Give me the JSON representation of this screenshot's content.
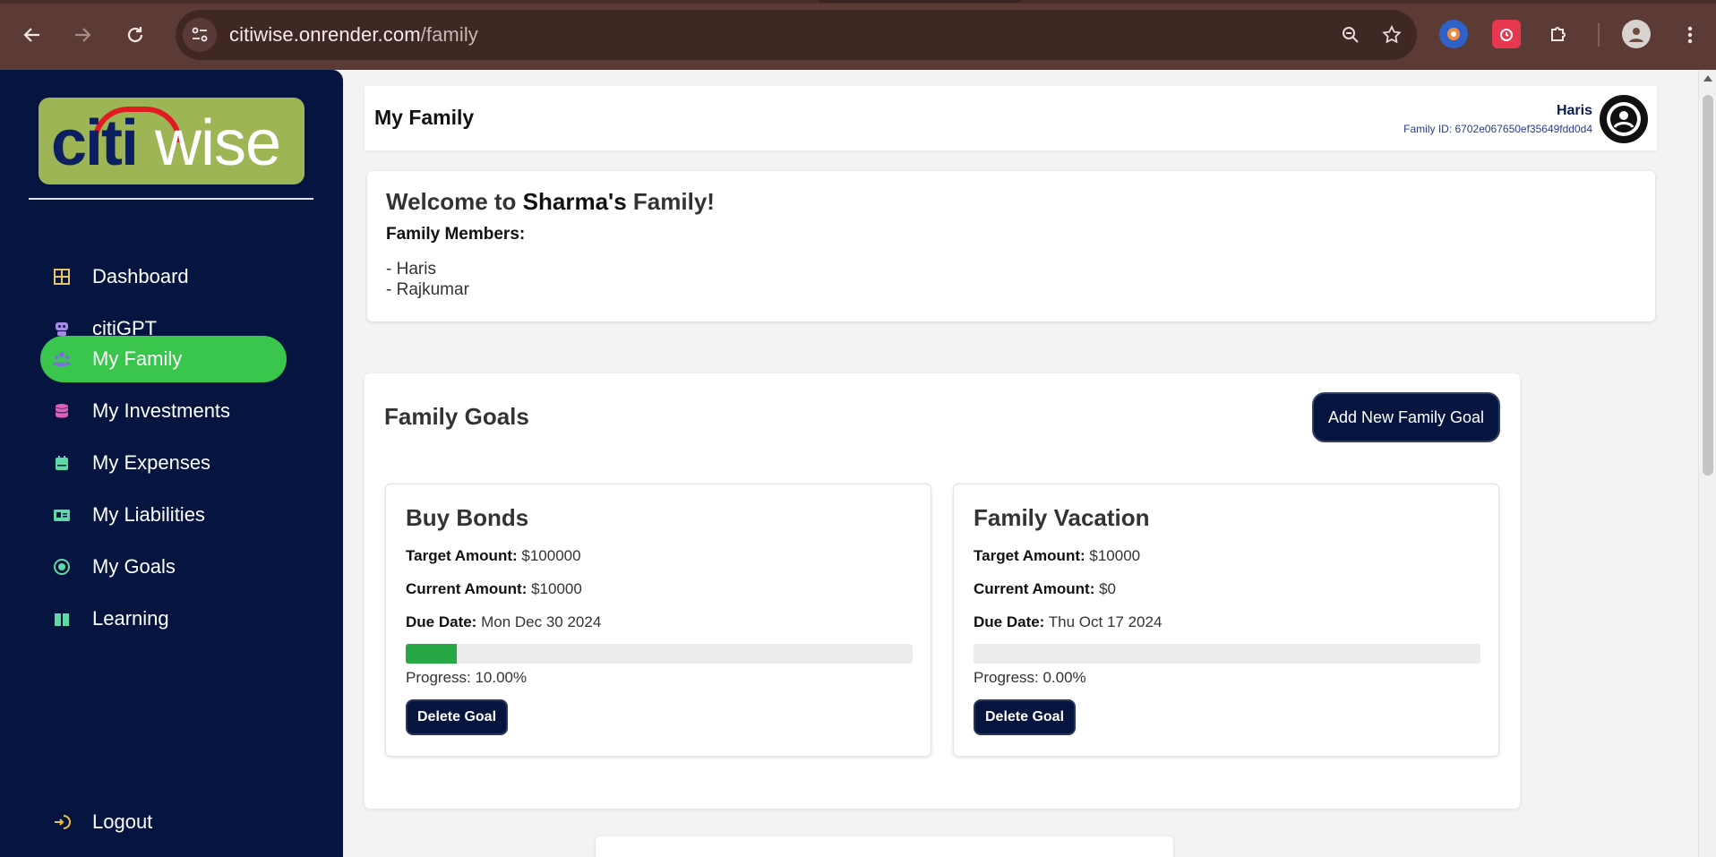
{
  "browser": {
    "url_host": "citiwise.onrender.com",
    "url_path": "/family"
  },
  "sidebar": {
    "logo_text_citi": "citi",
    "logo_text_wise": "wise",
    "items": [
      {
        "label": "Dashboard",
        "icon": "grid-icon",
        "color": "#e7c36a"
      },
      {
        "label": "citiGPT",
        "icon": "robot-icon",
        "color": "#a88be6"
      },
      {
        "label": "My Family",
        "icon": "family-icon",
        "color": "#7b6fe0"
      },
      {
        "label": "My Investments",
        "icon": "database-icon",
        "color": "#e05fb4"
      },
      {
        "label": "My Expenses",
        "icon": "calendar-icon",
        "color": "#5fd8a5"
      },
      {
        "label": "My Liabilities",
        "icon": "id-card-icon",
        "color": "#5fd8a5"
      },
      {
        "label": "My Goals",
        "icon": "target-icon",
        "color": "#5fd8a5"
      },
      {
        "label": "Learning",
        "icon": "book-icon",
        "color": "#5fd8a5"
      }
    ],
    "logout": "Logout"
  },
  "header": {
    "title": "My Family",
    "user_name": "Haris",
    "family_id": "Family ID: 6702e067650ef35649fdd0d4"
  },
  "welcome": {
    "prefix": "Welcome to ",
    "family_name": "Sharma's",
    "suffix": " Family!",
    "members_label": "Family Members:",
    "members": [
      "- Haris",
      "- Rajkumar"
    ]
  },
  "goals": {
    "title": "Family Goals",
    "add_button": "Add New Family Goal",
    "delete_label": "Delete Goal",
    "target_label": "Target Amount:",
    "current_label": "Current Amount:",
    "due_label": "Due Date:",
    "items": [
      {
        "name": "Buy Bonds",
        "target": "$100000",
        "current": "$10000",
        "due": "Mon Dec 30 2024",
        "progress": 0.1,
        "progress_text": "Progress: 10.00%"
      },
      {
        "name": "Family Vacation",
        "target": "$10000",
        "current": "$0",
        "due": "Thu Oct 17 2024",
        "progress": 0.0,
        "progress_text": "Progress: 0.00%"
      }
    ]
  },
  "colors": {
    "sidebar_bg": "#06153f",
    "active_item": "#3ac54d",
    "progress_fill": "#28a745",
    "button_bg": "#06153f"
  }
}
